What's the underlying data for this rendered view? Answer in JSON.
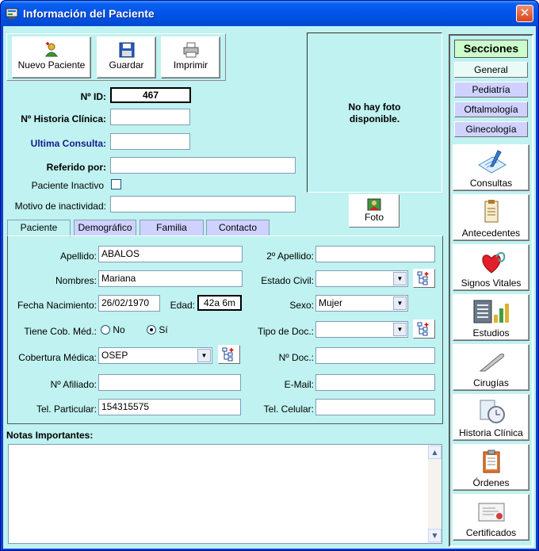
{
  "window": {
    "title": "Información del Paciente",
    "close_symbol": "✕"
  },
  "toolbar": {
    "new_patient": "Nuevo Paciente",
    "save": "Guardar",
    "print": "Imprimir"
  },
  "photo": {
    "placeholder_line1": "No hay foto",
    "placeholder_line2": "disponible.",
    "button": "Foto"
  },
  "header_fields": {
    "id_label": "Nº ID:",
    "id_value": "467",
    "history_label": "Nº Historia Clínica:",
    "history_value": "",
    "last_visit_label": "Ultima Consulta:",
    "last_visit_value": "",
    "referred_label": "Referido por:",
    "referred_value": "",
    "inactive_label": "Paciente Inactivo",
    "inactive_reason_label": "Motivo de inactividad:",
    "inactive_reason_value": ""
  },
  "tabs": [
    "Paciente",
    "Demográfico",
    "Familia",
    "Contacto"
  ],
  "patient": {
    "surname_label": "Apellido:",
    "surname_value": "ABALOS",
    "second_surname_label": "2º Apellido:",
    "second_surname_value": "",
    "names_label": "Nombres:",
    "names_value": "Mariana",
    "civil_status_label": "Estado Civil:",
    "civil_status_value": "",
    "birth_label": "Fecha Nacimiento:",
    "birth_value": "26/02/1970",
    "age_label": "Edad:",
    "age_value": "42a 6m",
    "sex_label": "Sexo:",
    "sex_value": "Mujer",
    "coverage_flag_label": "Tiene Cob. Méd.:",
    "radio_no": "No",
    "radio_yes": "Sí",
    "doc_type_label": "Tipo de Doc.:",
    "doc_type_value": "",
    "coverage_label": "Cobertura Médica:",
    "coverage_value": "OSEP",
    "doc_number_label": "Nº Doc.:",
    "doc_number_value": "",
    "affiliate_label": "Nº Afiliado:",
    "affiliate_value": "",
    "email_label": "E-Mail:",
    "email_value": "",
    "phone_label": "Tel. Particular:",
    "phone_value": "154315575",
    "mobile_label": "Tel. Celular:",
    "mobile_value": ""
  },
  "notes": {
    "label": "Notas Importantes:",
    "value": ""
  },
  "sections": {
    "title": "Secciones",
    "small": [
      "General",
      "Pediatría",
      "Oftalmología",
      "Ginecología"
    ],
    "big": [
      "Consultas",
      "Antecedentes",
      "Signos Vitales",
      "Estudios",
      "Cirugías",
      "Historia Clínica",
      "Órdenes",
      "Certificados"
    ]
  },
  "colors": {
    "background": "#bff2f0",
    "titlebar": "#0053e6",
    "tab_inactive": "#cfd2ff",
    "section_title": "#ccfecc",
    "general_btn": "#e8fbf6",
    "specialty_btn": "#cfd2ff"
  }
}
